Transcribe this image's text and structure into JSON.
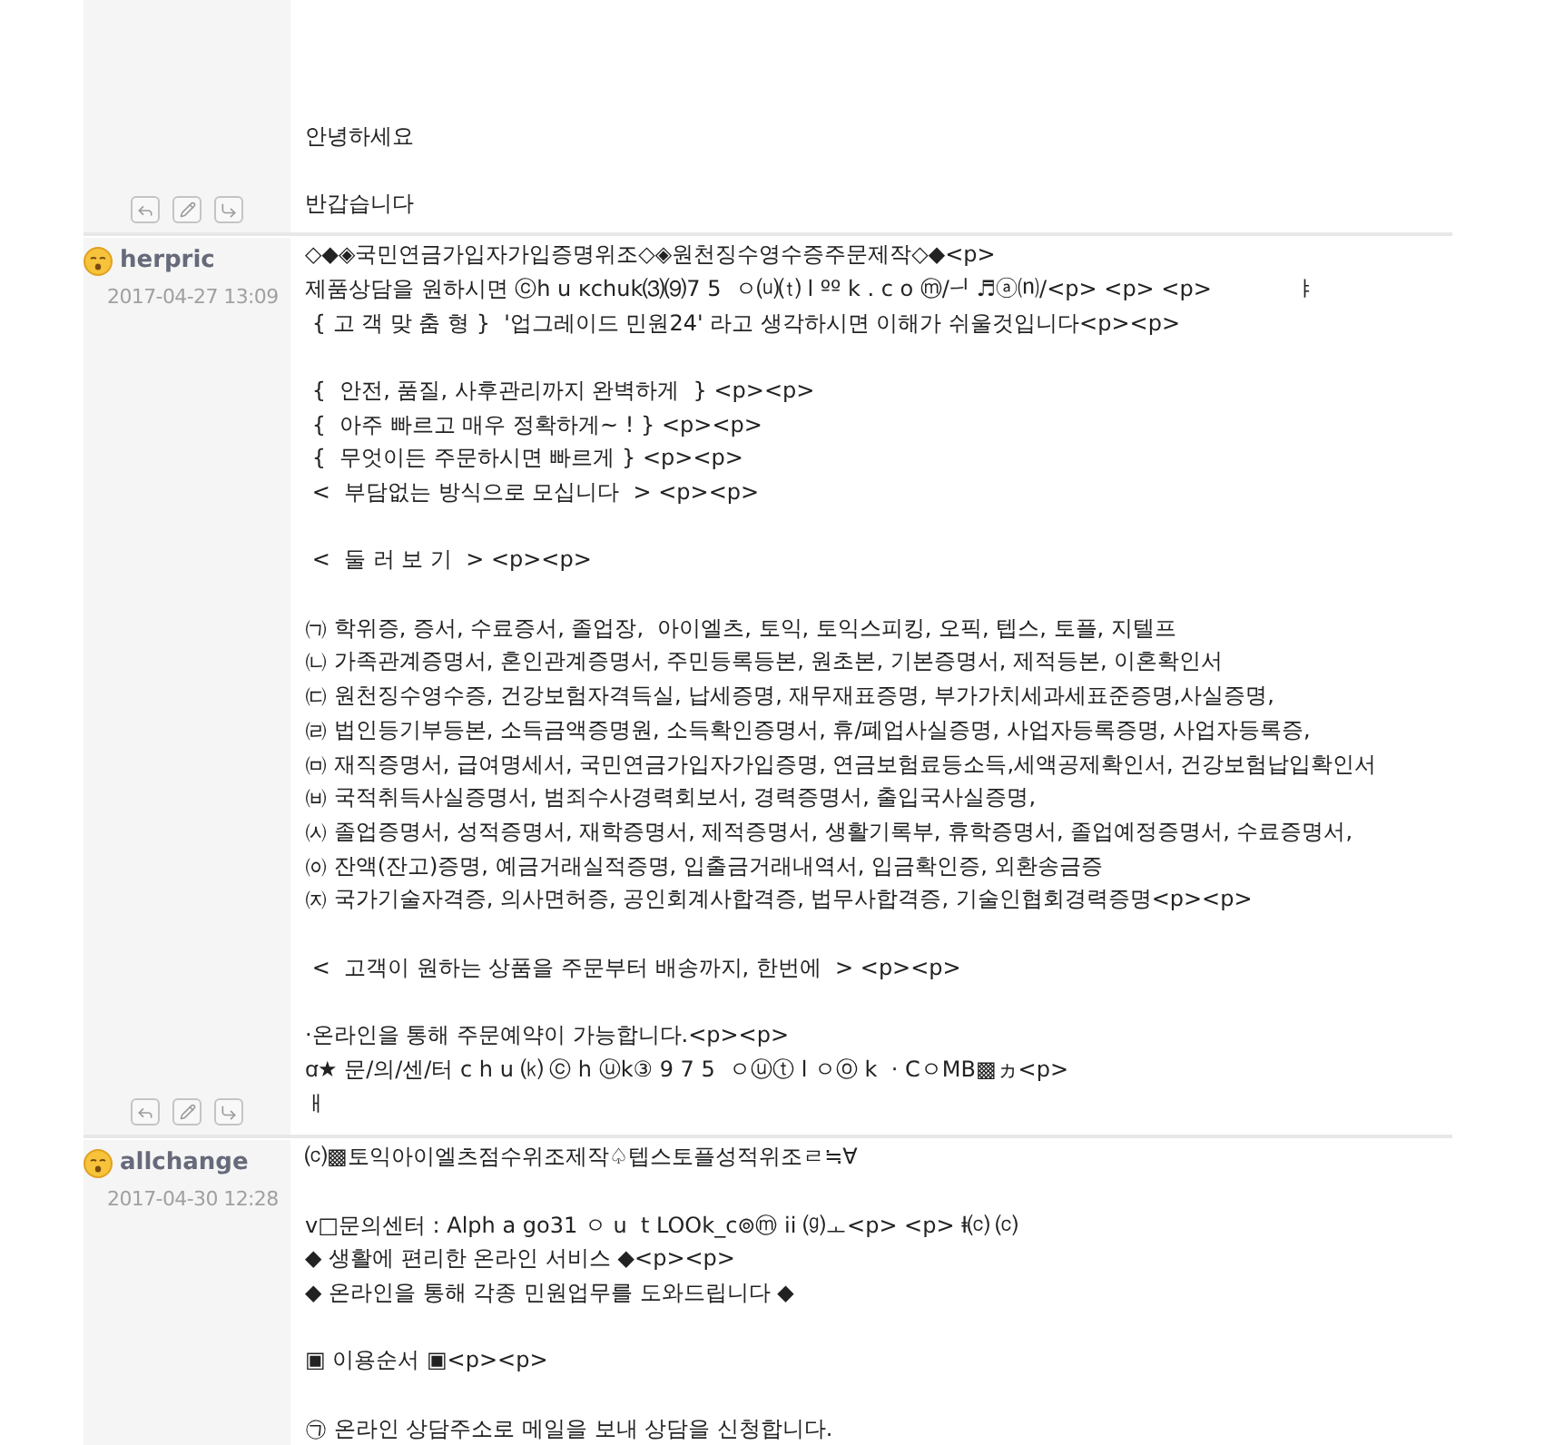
{
  "posts": [
    {
      "paragraphs": [
        [
          "안녕하세요"
        ],
        [
          "반갑습니다"
        ]
      ]
    },
    {
      "author": "herpric",
      "date": "2017-04-27 13:09",
      "paragraphs": [
        [
          "◇◆◈국민연금가입자가입증명위조◇◈원천징수영수증주문제작◇◆<p>",
          "제품상담을 원하시면 ⓒh u ĸchuk⑶⑼7 5  ㅇ⒰⒯ l ºº k . c o ⓜ/ᅴ ♬ⓐ⒩/<p> <p> <p>            ㅑ",
          " { 고 객 맞 춤 형 }  '업그레이드 민원24' 라고 생각하시면 이해가 쉬울것입니다<p><p>"
        ],
        [
          " {  안전, 품질, 사후관리까지 완벽하게  } <p><p>",
          " {  아주 빠르고 매우 정확하게~ ! } <p><p>",
          " {  무엇이든 주문하시면 빠르게 } <p><p>",
          " <  부담없는 방식으로 모십니다  > <p><p>"
        ],
        [
          " <  둘 러 보 기  > <p><p>"
        ],
        [
          "㈀ 학위증, 증서, 수료증서, 졸업장,  아이엘츠, 토익, 토익스피킹, 오픽, 텝스, 토플, 지텔프",
          "㈁ 가족관계증명서, 혼인관계증명서, 주민등록등본, 원초본, 기본증명서, 제적등본, 이혼확인서",
          "㈂ 원천징수영수증, 건강보험자격득실, 납세증명, 재무재표증명, 부가가치세과세표준증명,사실증명,",
          "㈃ 법인등기부등본, 소득금액증명원, 소득확인증명서, 휴/폐업사실증명, 사업자등록증명, 사업자등록증,",
          "㈄ 재직증명서, 급여명세서, 국민연금가입자가입증명, 연금보험료등소득,세액공제확인서, 건강보험납입확인서",
          "㈅ 국적취득사실증명서, 범죄수사경력회보서, 경력증명서, 출입국사실증명,",
          "㈆ 졸업증명서, 성적증명서, 재학증명서, 제적증명서, 생활기록부, 휴학증명서, 졸업예정증명서, 수료증명서,",
          "㈇ 잔액(잔고)증명, 예금거래실적증명, 입출금거래내역서, 입금확인증, 외환송금증",
          "㈈ 국가기술자격증, 의사면허증, 공인회계사합격증, 법무사합격증, 기술인협회경력증명<p><p>"
        ],
        [
          " <  고객이 원하는 상품을 주문부터 배송까지, 한번에  > <p><p>"
        ],
        [
          "·온라인을 통해 주문예약이 가능합니다.<p><p>",
          "ꭤ★ 문/의/센/터 c h u ⒦ ⓒ h ⓤk③ 9 7 5  ㅇⓤⓣ l ㅇⓞ k  · CㅇMB▩ヵ<p>",
          "ㅐ"
        ]
      ]
    },
    {
      "author": "allchange",
      "date": "2017-04-30 12:28",
      "paragraphs": [
        [
          "⒞▩토익아이엘츠점수위조제작♤텝스토플성적위조ㄹ≒∀"
        ],
        [
          "v□문의센터 : Alph a go31 ㅇ u  t LOOk_c⊚ⓜ ii ⒢ㅗ<p> <p> ⱡ⒞ ⒞",
          "◆ 생활에 편리한 온라인 서비스 ◆<p><p>",
          "◆ 온라인을 통해 각종 민원업무를 도와드립니다 ◆"
        ],
        [
          "▣ 이용순서 ▣<p><p>"
        ],
        [
          "㉠ 온라인 상담주소로 메일을 보내 상담을 신청합니다."
        ]
      ]
    }
  ]
}
